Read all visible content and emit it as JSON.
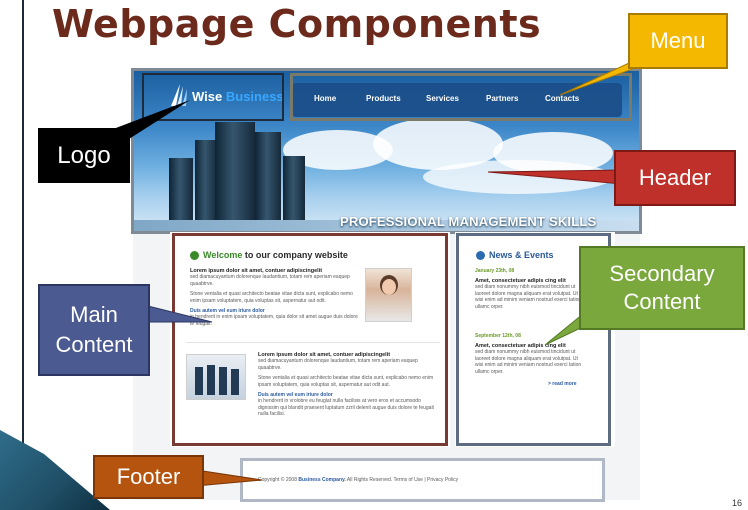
{
  "slide": {
    "title": "Webpage Components",
    "page_number": "16"
  },
  "site": {
    "logo_word1": "Wise",
    "logo_word2": "Business",
    "nav": [
      "Home",
      "Products",
      "Services",
      "Partners",
      "Contacts"
    ],
    "tagline": "PROFESSIONAL MANAGEMENT SKILLS"
  },
  "main": {
    "heading_accent": "Welcome",
    "heading_rest": "to our company website",
    "block1_bold": "Lorem ipsum dolor sit amet, contuer adipiscingelit",
    "block1_text": "sed diamacuyantum dolorenque laudantium, totam rem aperiam eaquep quaabtrve.",
    "block1_text2": "Stone ventalia et quasi architecto beatae vitae dicta sunt, explicabo nemo enim ipsam voluptatem, quia voluptas sit, aspernatur aut odit.",
    "block1_bold2": "Duis autem vel eum iriure dolor",
    "block1_text3": "in hendrerit in enim ipsam voluptatem, quia dolor sit amet augue duis dolore te feugait.",
    "block2_bold": "Lorem ipsum dolor sit amet, contuer adipiscingelit",
    "block2_text": "sed diamacuyantum dolorenque laudantium, totam rem aperiam eaquep quaabtrve.",
    "block2_text2": "Stone ventalia et quasi architecto beatae vitae dicta sunt, explicabo nemo enim ipsam voluptatem, quia voluptas sit, aspernatur aut odit aut.",
    "block2_bold2": "Duis autem vel eum iriure dolor",
    "block2_text3": "in hendrerit in vrolobre eu feugiat nulla facilisis at vero eros et accumsodo dignissim qui blandit praesent luptatum zzril delenit augue duis dolore te feugait nulla facilisi."
  },
  "secondary": {
    "heading": "News & Events",
    "date1": "January 23th, 08",
    "item1_bold": "Amet, consectetuer adipis cing elit",
    "item1_text": "sed diam nonummy nibh euismod tincidunt ut laoreet dolore magna aliquam erat volutpat. Ut wisi enim ad minim veniam nostrud exerci tation ullamc orper.",
    "date2": "September 12th, 08",
    "item2_bold": "Amet, consectetuer adipis cing elit",
    "item2_text": "sed diam nonummy nibh euismod tincidunt ut laoreet dolore magna aliquam erat volutpat. Ut wisi enim ad minim veniam nostrud exerci tation ullamc orper.",
    "read_more": "> read more"
  },
  "footer": {
    "copyright": "Copyright © 2008",
    "company": "Business Company.",
    "rights": "All Rights Reserved. Terms of Use  |  Privacy Policy"
  },
  "callouts": {
    "menu": "Menu",
    "logo": "Logo",
    "header": "Header",
    "secondary_line1": "Secondary",
    "secondary_line2": "Content",
    "main_line1": "Main",
    "main_line2": "Content",
    "footer": "Footer"
  },
  "colors": {
    "title": "#6b2a1b",
    "menu_callout": "#f5b800",
    "header_callout": "#c0302b",
    "secondary_callout": "#7aa83d",
    "main_callout": "#4b5a90",
    "footer_callout": "#b4540f",
    "logo_callout": "#000000"
  }
}
